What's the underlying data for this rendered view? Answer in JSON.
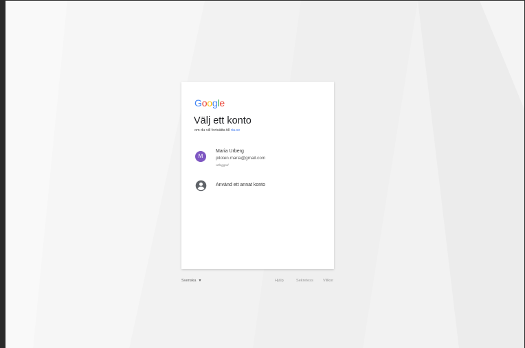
{
  "logo": {
    "text": "Google",
    "letters": [
      {
        "ch": "G",
        "color": "#4285F4"
      },
      {
        "ch": "o",
        "color": "#EA4335"
      },
      {
        "ch": "o",
        "color": "#FBBC05"
      },
      {
        "ch": "g",
        "color": "#4285F4"
      },
      {
        "ch": "l",
        "color": "#34A853"
      },
      {
        "ch": "e",
        "color": "#EA4335"
      }
    ]
  },
  "card": {
    "title": "Välj ett konto",
    "subtitle_prefix": "om du vill fortsätta till",
    "subtitle_link": "ria.se"
  },
  "account": {
    "initial": "M",
    "name": "Maria Urberg",
    "email": "piloten.maria@gmail.com",
    "status": "Utloggad",
    "avatar_color": "#7e57c2"
  },
  "other_account": {
    "label": "Använd ett annat konto",
    "icon": "account-circle-icon"
  },
  "footer": {
    "language": "Svenska",
    "help": "Hjälp",
    "privacy": "Sekretess",
    "terms": "Villkor"
  }
}
